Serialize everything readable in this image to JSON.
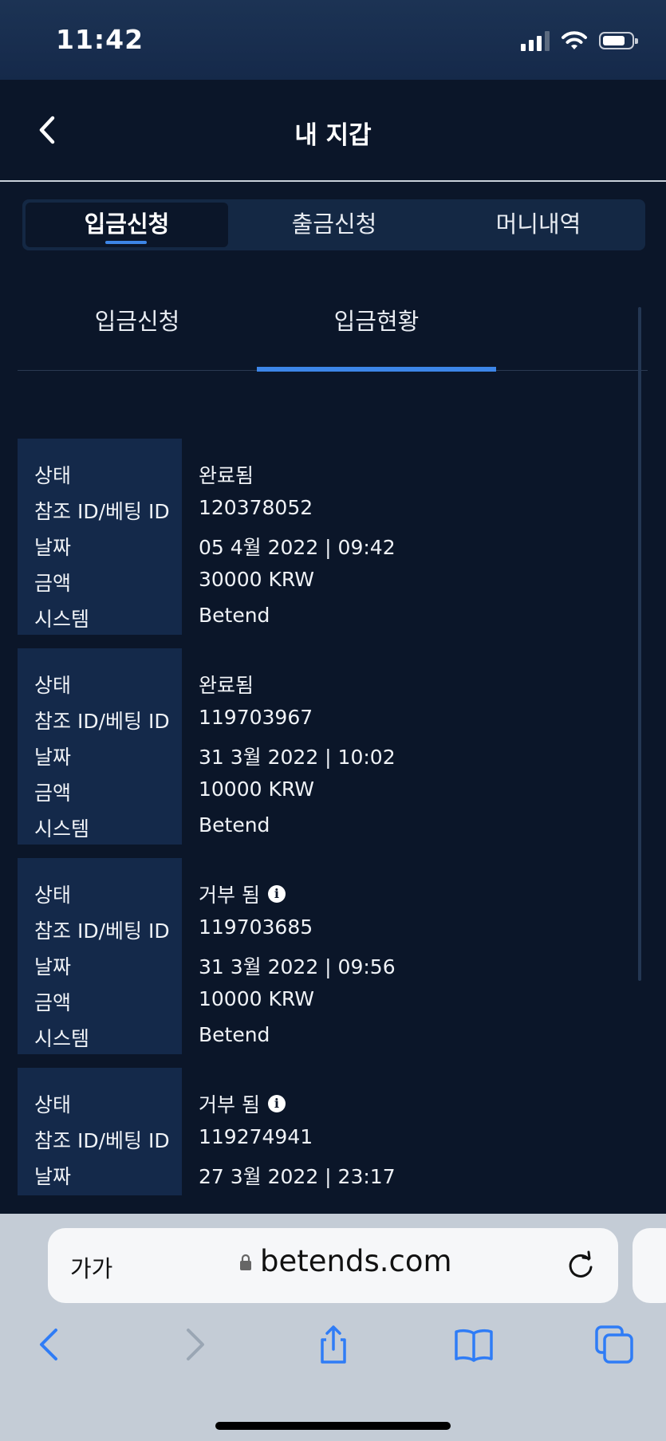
{
  "status_bar": {
    "time": "11:42"
  },
  "header": {
    "title": "내 지갑"
  },
  "tabs": [
    {
      "label": "입금신청",
      "active": true
    },
    {
      "label": "출금신청",
      "active": false
    },
    {
      "label": "머니내역",
      "active": false
    }
  ],
  "subtabs": [
    {
      "label": "입금신청",
      "active": false
    },
    {
      "label": "입금현황",
      "active": true
    }
  ],
  "field_labels": {
    "status": "상태",
    "ref": "참조 ID/베팅 ID",
    "date": "날짜",
    "amount": "금액",
    "system": "시스템"
  },
  "records": [
    {
      "status": "완료됨",
      "ref": "120378052",
      "date": "05 4월 2022 | 09:42",
      "amount": "30000 KRW",
      "system": "Betend",
      "info_icon": false
    },
    {
      "status": "완료됨",
      "ref": "119703967",
      "date": "31 3월 2022 | 10:02",
      "amount": "10000 KRW",
      "system": "Betend",
      "info_icon": false
    },
    {
      "status": "거부 됨",
      "ref": "119703685",
      "date": "31 3월 2022 | 09:56",
      "amount": "10000 KRW",
      "system": "Betend",
      "info_icon": true
    },
    {
      "status": "거부 됨",
      "ref": "119274941",
      "date": "27 3월 2022 | 23:17",
      "info_icon": true
    }
  ],
  "browser": {
    "text_size_label": "가가",
    "url": "betends.com"
  },
  "colors": {
    "background": "#0b1629",
    "label_panel": "#14294a",
    "accent": "#3d86e8",
    "browser_bar": "#c4ccd6",
    "ios_blue": "#2f7cf6"
  }
}
